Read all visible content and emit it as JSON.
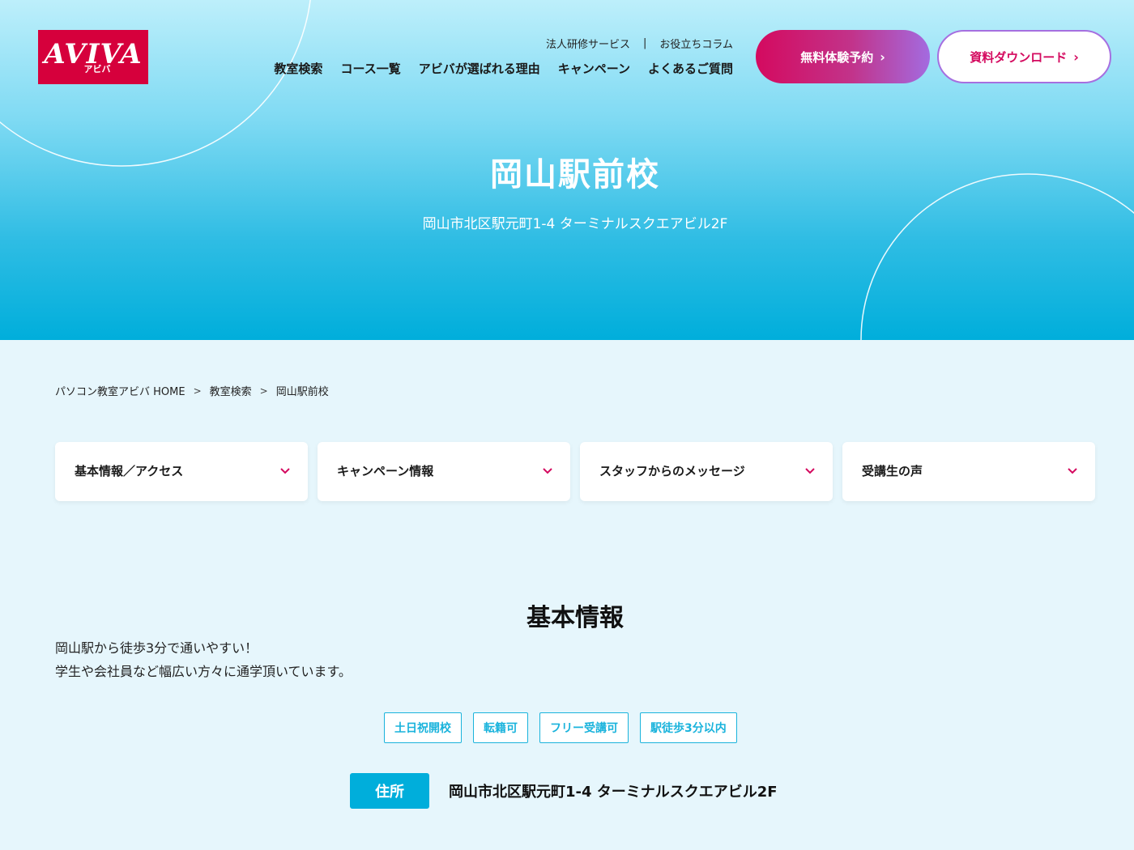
{
  "logo": {
    "word": "AVIVA",
    "kana": "アビバ"
  },
  "subnav": {
    "corporate": "法人研修サービス",
    "separator": "|",
    "column": "お役立ちコラム"
  },
  "mainnav": [
    "教室検索",
    "コース一覧",
    "アビバが選ばれる理由",
    "キャンペーン",
    "よくあるご質問"
  ],
  "buttons": {
    "trial": "無料体験予約",
    "download": "資料ダウンロード",
    "chevron": "›"
  },
  "hero": {
    "title": "岡山駅前校",
    "address": "岡山市北区駅元町1-4 ターミナルスクエアビル2F"
  },
  "breadcrumb": [
    "パソコン教室アビバ HOME",
    "教室検索",
    "岡山駅前校"
  ],
  "breadcrumb_sep": ">",
  "anchors": [
    "基本情報／アクセス",
    "キャンペーン情報",
    "スタッフからのメッセージ",
    "受講生の声"
  ],
  "basic_info": {
    "title": "基本情報",
    "desc_line1": "岡山駅から徒歩3分で通いやすい！",
    "desc_line2": "学生や会社員など幅広い方々に通学頂いています。",
    "tags": [
      "土日祝開校",
      "転籍可",
      "フリー受講可",
      "駅徒歩3分以内"
    ],
    "address_label": "住所",
    "address_value": "岡山市北区駅元町1-4 ターミナルスクエアビル2F"
  },
  "colors": {
    "brand": "#d6003c",
    "accent": "#00aedb",
    "pink": "#d40a5f"
  }
}
